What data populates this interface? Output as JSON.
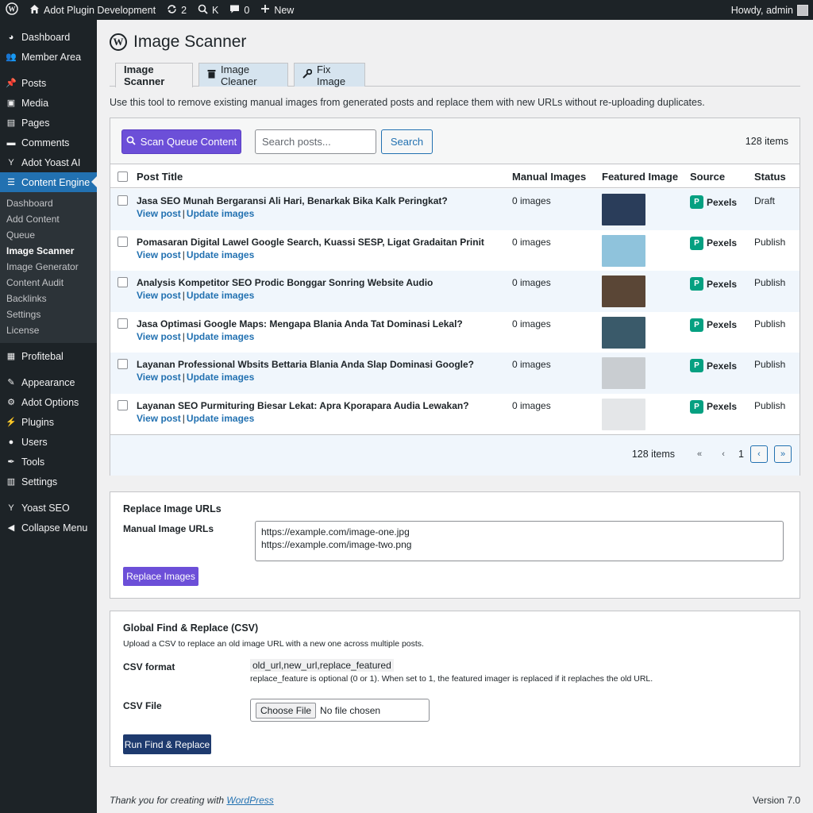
{
  "adminbar": {
    "site_name": "Adot Plugin Development",
    "updates_count": "2",
    "search_label": "K",
    "comments_count": "0",
    "new_label": "New",
    "greeting": "Howdy, admin"
  },
  "sidebar": {
    "items_top": [
      {
        "label": "Dashboard",
        "icon": "dashboard-icon"
      },
      {
        "label": "Member Area",
        "icon": "users-icon"
      }
    ],
    "items_content": [
      {
        "label": "Posts",
        "icon": "pin-icon"
      },
      {
        "label": "Media",
        "icon": "media-icon"
      },
      {
        "label": "Pages",
        "icon": "pages-icon"
      },
      {
        "label": "Comments",
        "icon": "comment-icon"
      },
      {
        "label": "Adot Yoast AI",
        "icon": "yoast-icon"
      },
      {
        "label": "Content Engine",
        "icon": "content-engine-icon"
      }
    ],
    "submenu": [
      "Dashboard",
      "Add Content",
      "Queue",
      "Image Scanner",
      "Image Generator",
      "Content Audit",
      "Backlinks",
      "Settings",
      "License"
    ],
    "items_mid": [
      {
        "label": "Profitebal",
        "icon": "building-icon"
      }
    ],
    "items_bottom": [
      {
        "label": "Appearance",
        "icon": "brush-icon"
      },
      {
        "label": "Adot Options",
        "icon": "gear-icon"
      },
      {
        "label": "Plugins",
        "icon": "plugin-icon"
      },
      {
        "label": "Users",
        "icon": "user-icon"
      },
      {
        "label": "Tools",
        "icon": "wrench-icon"
      },
      {
        "label": "Settings",
        "icon": "settings-icon"
      }
    ],
    "items_end": [
      {
        "label": "Yoast SEO",
        "icon": "yoast-icon"
      },
      {
        "label": "Collapse Menu",
        "icon": "collapse-icon"
      }
    ]
  },
  "page": {
    "title": "Image Scanner",
    "tabs": [
      "Image Scanner",
      "Image Cleaner",
      "Fix Image"
    ],
    "intro": "Use this tool to remove existing manual images from generated posts and replace them with new URLs without re-uploading duplicates."
  },
  "table": {
    "scan_button": "Scan Queue Content",
    "search_placeholder": "Search posts...",
    "search_button": "Search",
    "items_count": "128 items",
    "headers": {
      "title": "Post Title",
      "manual": "Manual Images",
      "featured": "Featured Image",
      "source": "Source",
      "status": "Status"
    },
    "rows": [
      {
        "title": "Jasa SEO Munah Bergaransi Ali Hari, Benarkak Bika Kalk Peringkat?",
        "view": "View post",
        "update": "Update images",
        "manual": "0 images",
        "source": "Pexels",
        "status": "Draft",
        "thumb_color": "#2a3d5a"
      },
      {
        "title": "Pomasaran Digital Lawel Google Search, Kuassi SESP, Ligat Gradaitan Prinit",
        "view": "View post",
        "update": "Update images",
        "manual": "0 images",
        "source": "Pexels",
        "status": "Publish",
        "thumb_color": "#8fc3dc"
      },
      {
        "title": "Analysis Kompetitor SEO Prodic Bonggar Sonring Website Audio",
        "view": "View post",
        "update": "Update images",
        "manual": "0 images",
        "source": "Pexels",
        "status": "Publish",
        "thumb_color": "#5a4636"
      },
      {
        "title": "Jasa Optimasi Google Maps: Mengapa Blania Anda Tat Dominasi Lekal?",
        "view": "View post",
        "update": "Update images",
        "manual": "0 images",
        "source": "Pexels",
        "status": "Publish",
        "thumb_color": "#3a5a6a"
      },
      {
        "title": "Layanan Professional Wbsits Bettaria Blania Anda Slap Dominasi Google?",
        "view": "View post",
        "update": "Update images",
        "manual": "0 images",
        "source": "Pexels",
        "status": "Publish",
        "thumb_color": "#c9cdd1"
      },
      {
        "title": "Layanan SEO Purmituring Biesar Lekat: Apra Kporapara Audia Lewakan?",
        "view": "View post",
        "update": "Update images",
        "manual": "0 images",
        "source": "Pexels",
        "status": "Publish",
        "thumb_color": "#e4e6e8"
      }
    ],
    "footer_count": "128 items",
    "pager": {
      "first": "«",
      "prev": "‹",
      "page": "1",
      "next": "‹",
      "last": "»"
    }
  },
  "replace": {
    "heading": "Replace Image URLs",
    "label": "Manual Image URLs",
    "urls": [
      "https://example.com/image-one.jpg",
      "https://example.com/image-two.png"
    ],
    "button": "Replace Images"
  },
  "csv": {
    "heading": "Global Find & Replace (CSV)",
    "description": "Upload a CSV to replace an old image URL with a new one across multiple posts.",
    "format_label": "CSV format",
    "format_code": "old_url,new_url,replace_featured",
    "format_note": "replace_feature is optional (0 or 1). When set to 1, the featured imager is replaced if it replaches the old URL.",
    "file_label": "CSV File",
    "choose_file": "Choose File",
    "no_file": "No file chosen",
    "button": "Run Find & Replace"
  },
  "footer": {
    "thanks": "Thank you for creating with",
    "link": "WordPress",
    "version": "Version 7.0"
  },
  "colors": {
    "accent_purple": "#6c4fd8",
    "wp_blue": "#2271b1",
    "admin_dark": "#1d2327",
    "navy": "#1e3a6e",
    "pexels_green": "#05a081"
  }
}
